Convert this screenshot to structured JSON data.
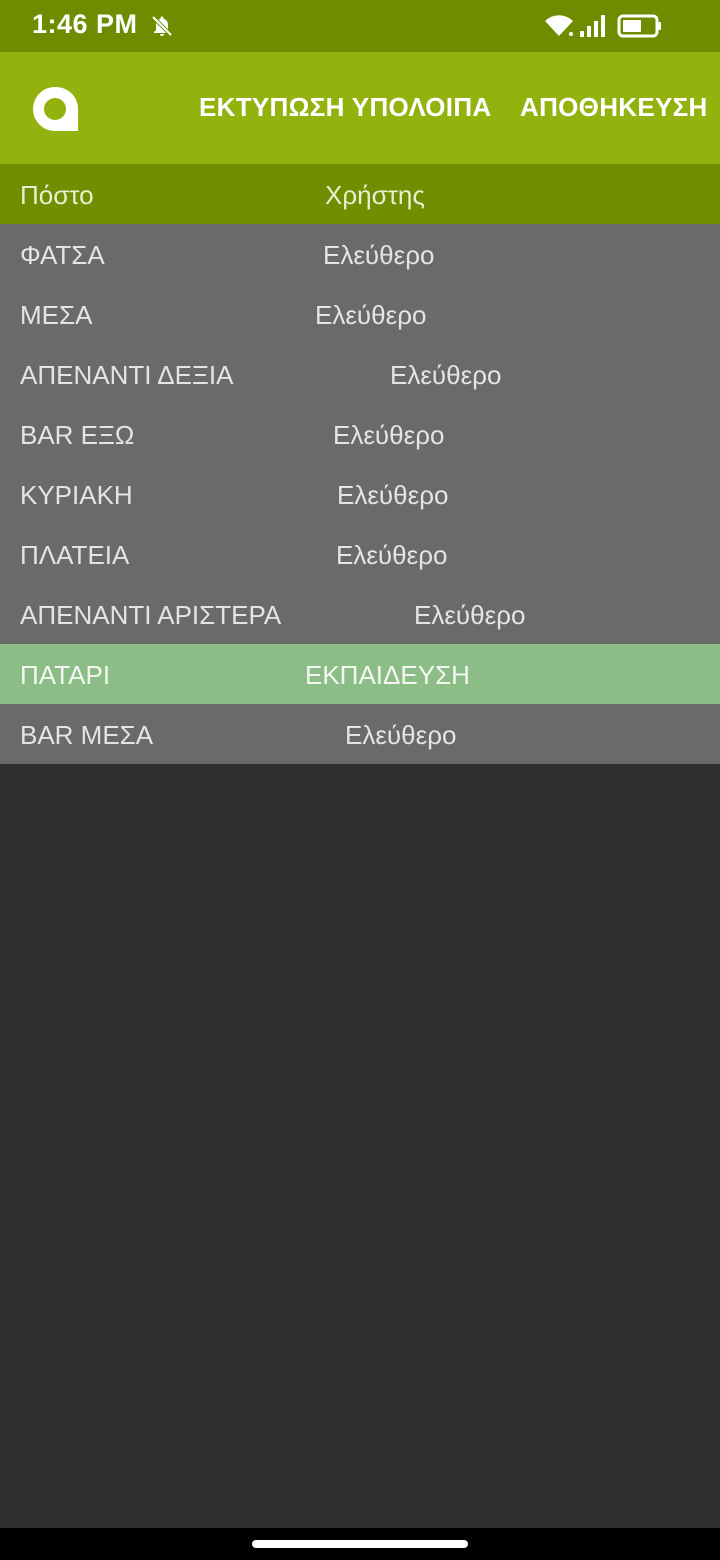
{
  "status_bar": {
    "time": "1:46 PM",
    "icons": [
      "bell-off-icon",
      "wifi-icon",
      "signal-icon",
      "battery-icon"
    ]
  },
  "app_bar": {
    "logo": "app-logo-icon",
    "actions": {
      "print_remaining": "ΕΚΤΥΠΩΣΗ ΥΠΟΛΟΙΠΑ",
      "save": "ΑΠΟΘΗΚΕΥΣΗ"
    }
  },
  "table": {
    "headers": {
      "post": "Πόστο",
      "user": "Χρήστης"
    },
    "rows": [
      {
        "post": "ΦΑΤΣΑ",
        "user": "Ελεύθερο",
        "selected": false
      },
      {
        "post": "ΜΕΣΑ",
        "user": "Ελεύθερο",
        "selected": false
      },
      {
        "post": "ΑΠΕΝΑΝΤΙ ΔΕΞΙΑ",
        "user": "Ελεύθερο",
        "selected": false
      },
      {
        "post": "BAR ΕΞΩ",
        "user": "Ελεύθερο",
        "selected": false
      },
      {
        "post": "ΚΥΡΙΑΚΗ",
        "user": "Ελεύθερο",
        "selected": false
      },
      {
        "post": "ΠΛΑΤΕΙΑ",
        "user": "Ελεύθερο",
        "selected": false
      },
      {
        "post": "ΑΠΕΝΑΝΤΙ ΑΡΙΣΤΕΡΑ",
        "user": "Ελεύθερο",
        "selected": false
      },
      {
        "post": "ΠΑΤΑΡΙ",
        "user": "ΕΚΠΑΙΔΕΥΣΗ",
        "selected": true
      },
      {
        "post": "BAR ΜΕΣΑ",
        "user": "Ελεύθερο",
        "selected": false
      }
    ]
  },
  "colors": {
    "status_bar": "#6f8b00",
    "app_bar": "#93b20e",
    "table_header": "#718d00",
    "row": "#6a6a6a",
    "row_selected": "#8dbd87",
    "background": "#303030"
  }
}
